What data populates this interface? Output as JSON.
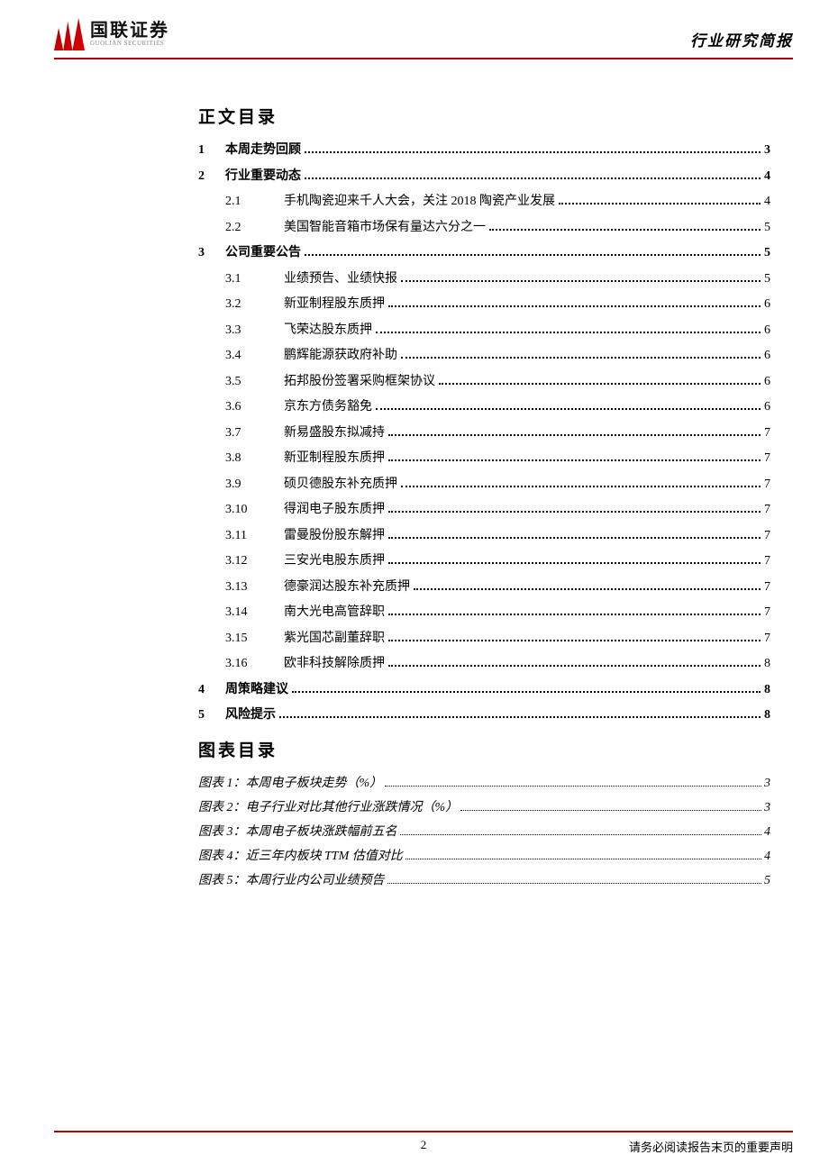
{
  "header": {
    "logo_cn": "国联证券",
    "logo_en": "GUOLIAN SECURITIES",
    "right": "行业研究简报"
  },
  "toc_title": "正文目录",
  "toc": [
    {
      "level": 1,
      "num": "1",
      "title": "本周走势回顾",
      "page": "3"
    },
    {
      "level": 1,
      "num": "2",
      "title": "行业重要动态",
      "page": "4"
    },
    {
      "level": 2,
      "num": "2.1",
      "title": "手机陶瓷迎来千人大会，关注 2018 陶瓷产业发展",
      "page": "4"
    },
    {
      "level": 2,
      "num": "2.2",
      "title": "美国智能音箱市场保有量达六分之一",
      "page": "5"
    },
    {
      "level": 1,
      "num": "3",
      "title": "公司重要公告",
      "page": "5"
    },
    {
      "level": 2,
      "num": "3.1",
      "title": "业绩预告、业绩快报",
      "page": "5"
    },
    {
      "level": 2,
      "num": "3.2",
      "title": "新亚制程股东质押",
      "page": "6"
    },
    {
      "level": 2,
      "num": "3.3",
      "title": "飞荣达股东质押",
      "page": "6"
    },
    {
      "level": 2,
      "num": "3.4",
      "title": "鹏辉能源获政府补助",
      "page": "6"
    },
    {
      "level": 2,
      "num": "3.5",
      "title": "拓邦股份签署采购框架协议",
      "page": "6"
    },
    {
      "level": 2,
      "num": "3.6",
      "title": "京东方债务豁免",
      "page": "6"
    },
    {
      "level": 2,
      "num": "3.7",
      "title": "新易盛股东拟减持",
      "page": "7"
    },
    {
      "level": 2,
      "num": "3.8",
      "title": "新亚制程股东质押",
      "page": "7"
    },
    {
      "level": 2,
      "num": "3.9",
      "title": "硕贝德股东补充质押",
      "page": "7"
    },
    {
      "level": 2,
      "num": "3.10",
      "title": "得润电子股东质押",
      "page": "7"
    },
    {
      "level": 2,
      "num": "3.11",
      "title": "雷曼股份股东解押",
      "page": "7"
    },
    {
      "level": 2,
      "num": "3.12",
      "title": "三安光电股东质押",
      "page": "7"
    },
    {
      "level": 2,
      "num": "3.13",
      "title": "德豪润达股东补充质押",
      "page": "7"
    },
    {
      "level": 2,
      "num": "3.14",
      "title": "南大光电高管辞职",
      "page": "7"
    },
    {
      "level": 2,
      "num": "3.15",
      "title": "紫光国芯副董辞职",
      "page": "7"
    },
    {
      "level": 2,
      "num": "3.16",
      "title": "欧非科技解除质押",
      "page": "8"
    },
    {
      "level": 1,
      "num": "4",
      "title": "周策略建议",
      "page": "8"
    },
    {
      "level": 1,
      "num": "5",
      "title": "风险提示",
      "page": "8"
    }
  ],
  "fig_title": "图表目录",
  "figures": [
    {
      "label": "图表 1：本周电子板块走势（%）",
      "page": "3"
    },
    {
      "label": "图表 2：电子行业对比其他行业涨跌情况（%）",
      "page": "3"
    },
    {
      "label": "图表 3：本周电子板块涨跌幅前五名",
      "page": "4"
    },
    {
      "label": "图表 4：近三年内板块 TTM 估值对比",
      "page": "4"
    },
    {
      "label": "图表 5：本周行业内公司业绩预告",
      "page": "5"
    }
  ],
  "footer": {
    "page_num": "2",
    "disclaimer": "请务必阅读报告末页的重要声明"
  }
}
